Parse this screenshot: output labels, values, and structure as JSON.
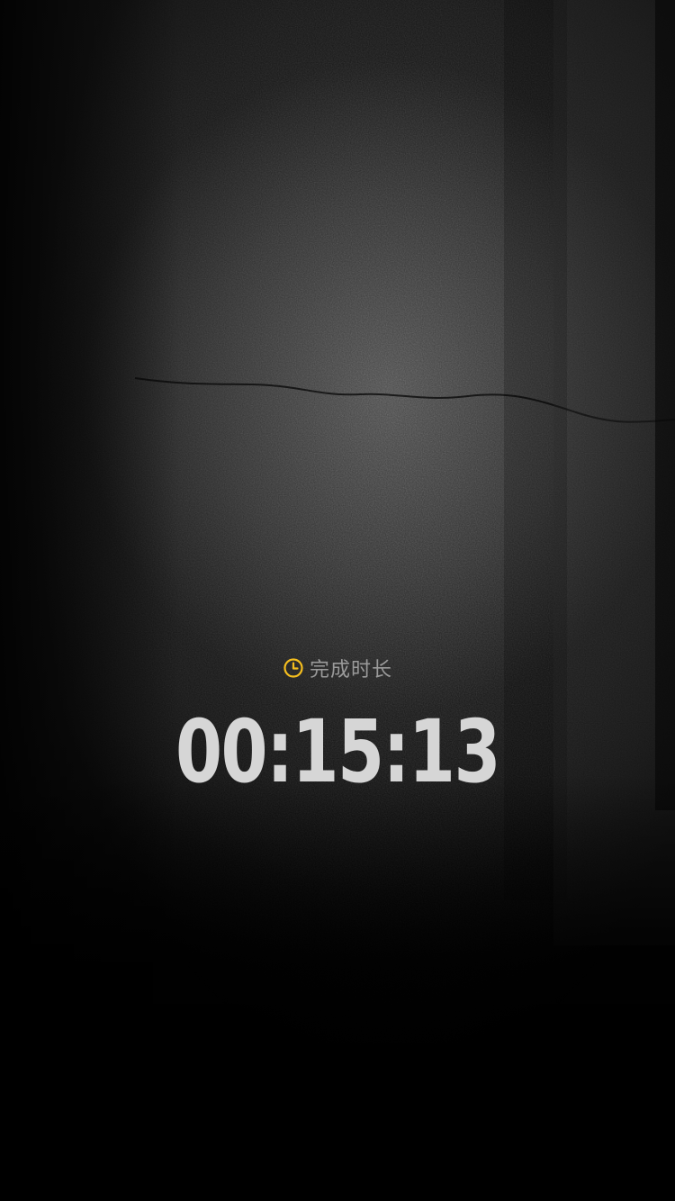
{
  "summary": {
    "label": "完成时长",
    "icon": "clock-icon",
    "duration": "00:15:13"
  },
  "colors": {
    "accent": "#F5BE1E",
    "label": "#9A9A9A",
    "duration": "#D6D6D6",
    "background": "#000000"
  }
}
